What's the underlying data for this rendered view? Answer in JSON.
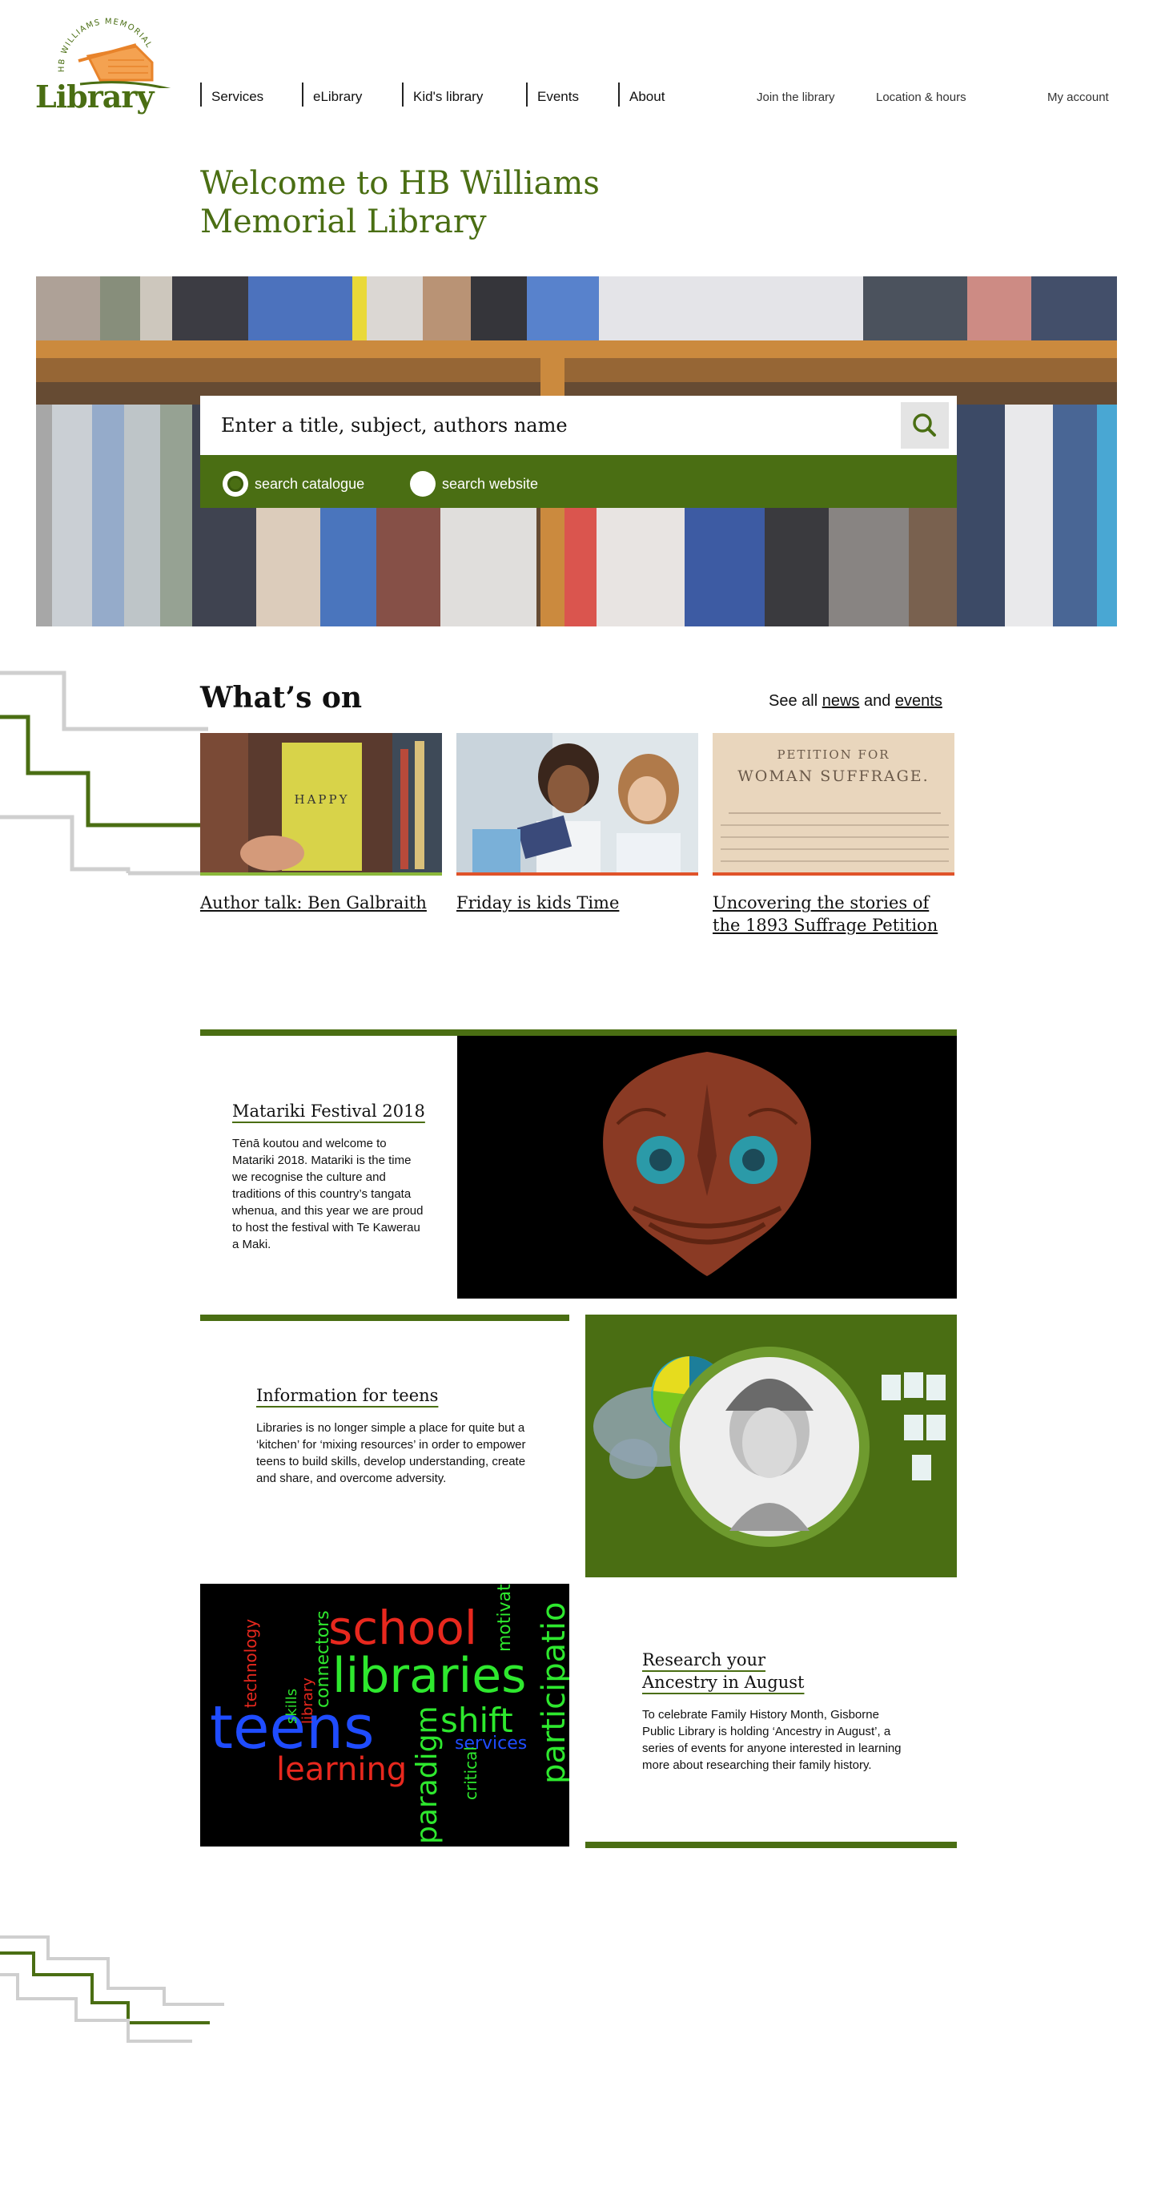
{
  "header": {
    "logo_arc": "HB WILLIAMS MEMORIAL",
    "logo_word": "Library",
    "nav": [
      "Services",
      "eLibrary",
      "Kid's library",
      "Events",
      "About"
    ],
    "join": "Join the library",
    "location": "Location & hours",
    "account": "My account"
  },
  "welcome": {
    "line1": "Welcome to HB Williams",
    "line2": "Memorial Library"
  },
  "search": {
    "placeholder": "Enter a title, subject, authors name",
    "option_catalogue": "search catalogue",
    "option_website": "search website"
  },
  "whats_on": {
    "title": "What’s on",
    "see_all": "See all",
    "news": "news",
    "and": "and",
    "events": "events",
    "cards": [
      {
        "title": "Author talk: Ben Galbraith",
        "book_word": "HAPPY"
      },
      {
        "title": "Friday is kids Time"
      },
      {
        "title": "Uncovering the stories of the 1893 Suffrage Petition",
        "doc_line1": "PETITION FOR",
        "doc_line2": "WOMAN SUFFRAGE."
      }
    ]
  },
  "features": {
    "matariki": {
      "title": "Matariki Festival 2018",
      "text": "Tēnā koutou and welcome to Matariki 2018. Matariki is the time we recognise the culture and traditions of this country’s tangata whenua, and this year we are proud to host the festival with Te Kawerau a Maki."
    },
    "teens": {
      "title": "Information for teens",
      "text": "Libraries is no longer simple a place for quite but a ‘kitchen’ for ‘mixing resources’ in order to empower teens to build skills, develop understanding, create and share, and overcome adversity."
    },
    "ancestry": {
      "title_line1": "Research your",
      "title_line2": "Ancestry in August",
      "text": "To celebrate Family History Month, Gisborne Public Library is holding ‘Ancestry in August’, a series of events for anyone interested in learning more about researching their family history."
    },
    "wordcloud": [
      "school",
      "libraries",
      "teens",
      "learning",
      "shift",
      "services",
      "paradigm",
      "participatio",
      "technology",
      "skills",
      "library",
      "connectors",
      "critical",
      "motivat"
    ]
  },
  "colors": {
    "brand_green": "#4a6e13",
    "logo_orange": "#e8832a"
  }
}
